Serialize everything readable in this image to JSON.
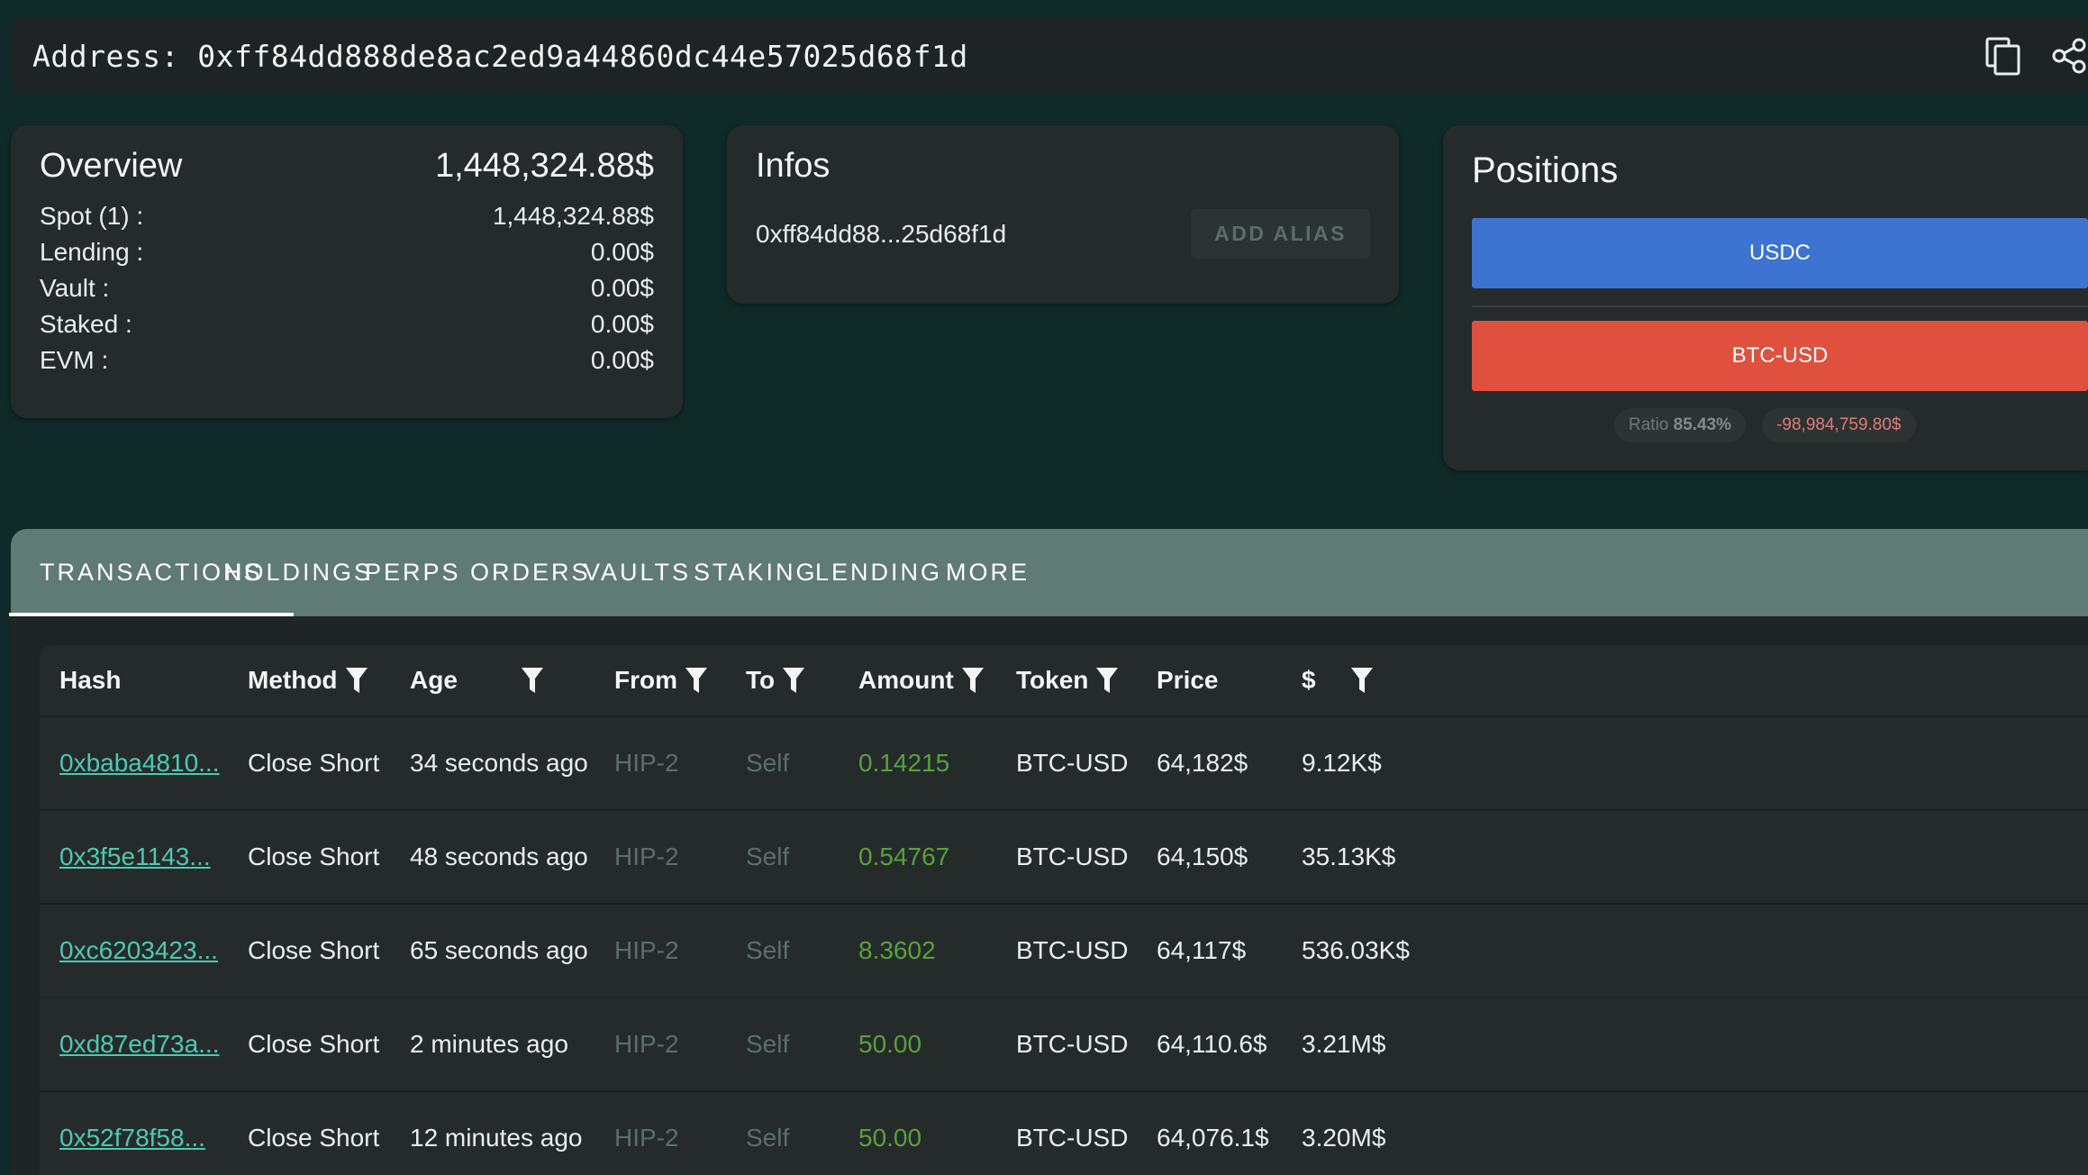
{
  "address_bar": {
    "text": "Address: 0xff84dd888de8ac2ed9a44860dc44e57025d68f1d"
  },
  "overview": {
    "title": "Overview",
    "total": "1,448,324.88$",
    "rows": [
      {
        "label": "Spot (1) :",
        "value": "1,448,324.88$"
      },
      {
        "label": "Lending :",
        "value": "0.00$"
      },
      {
        "label": "Vault :",
        "value": "0.00$"
      },
      {
        "label": "Staked :",
        "value": "0.00$"
      },
      {
        "label": "EVM :",
        "value": "0.00$"
      }
    ]
  },
  "infos": {
    "title": "Infos",
    "short_address": "0xff84dd88...25d68f1d",
    "add_alias_label": "ADD ALIAS"
  },
  "positions": {
    "title": "Positions",
    "bars": [
      {
        "label": "USDC",
        "color": "#3d73d1"
      },
      {
        "label": "BTC-USD",
        "color": "#e0503e"
      }
    ],
    "ratio_label": "Ratio",
    "ratio_value": "85.43%",
    "pnl": "-98,984,759.80$"
  },
  "tabs": [
    "TRANSACTIONS",
    "HOLDINGS",
    "PERPS",
    "ORDERS",
    "VAULTS",
    "STAKING",
    "LENDING",
    "MORE"
  ],
  "active_tab": "TRANSACTIONS",
  "table": {
    "columns": [
      "Hash",
      "Method",
      "Age",
      "From",
      "To",
      "Amount",
      "Token",
      "Price",
      "$"
    ],
    "rows": [
      {
        "hash": "0xbaba4810...",
        "method": "Close Short",
        "age": "34 seconds ago",
        "from": "HIP-2",
        "to": "Self",
        "amount": "0.14215",
        "token": "BTC-USD",
        "price": "64,182$",
        "usd": "9.12K$"
      },
      {
        "hash": "0x3f5e1143...",
        "method": "Close Short",
        "age": "48 seconds ago",
        "from": "HIP-2",
        "to": "Self",
        "amount": "0.54767",
        "token": "BTC-USD",
        "price": "64,150$",
        "usd": "35.13K$"
      },
      {
        "hash": "0xc6203423...",
        "method": "Close Short",
        "age": "65 seconds ago",
        "from": "HIP-2",
        "to": "Self",
        "amount": "8.3602",
        "token": "BTC-USD",
        "price": "64,117$",
        "usd": "536.03K$"
      },
      {
        "hash": "0xd87ed73a...",
        "method": "Close Short",
        "age": "2 minutes ago",
        "from": "HIP-2",
        "to": "Self",
        "amount": "50.00",
        "token": "BTC-USD",
        "price": "64,110.6$",
        "usd": "3.21M$"
      },
      {
        "hash": "0x52f78f58...",
        "method": "Close Short",
        "age": "12 minutes ago",
        "from": "HIP-2",
        "to": "Self",
        "amount": "50.00",
        "token": "BTC-USD",
        "price": "64,076.1$",
        "usd": "3.20M$"
      }
    ]
  },
  "icons": [
    "copy-icon",
    "share-icon",
    "filter-icon"
  ],
  "colors": {
    "accent_link": "#4fc9b0",
    "amount_green": "#5aa03c",
    "tabs_bg": "#5f7b74"
  }
}
